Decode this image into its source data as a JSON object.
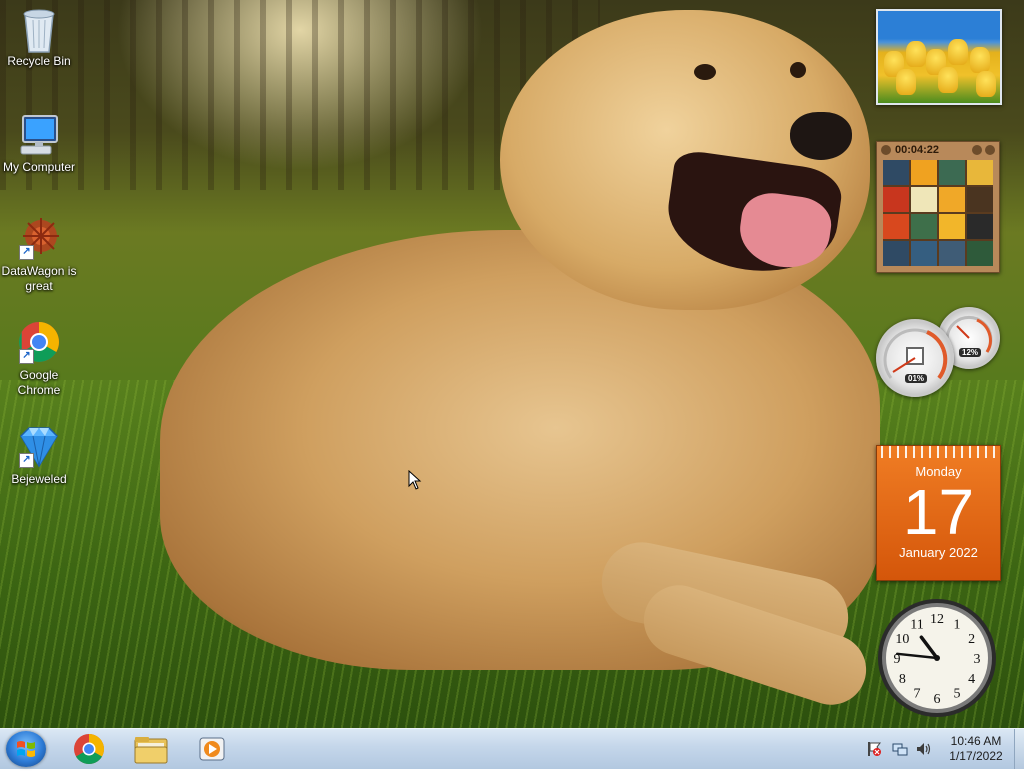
{
  "desktop": {
    "icons": [
      {
        "label": "Recycle Bin",
        "icon": "recycle-bin-icon"
      },
      {
        "label": "My Computer",
        "icon": "computer-icon"
      },
      {
        "label": "DataWagon is great",
        "icon": "datawagon-icon",
        "shortcut": true
      },
      {
        "label": "Google Chrome",
        "icon": "chrome-icon",
        "shortcut": true
      },
      {
        "label": "Bejeweled",
        "icon": "bejeweled-icon",
        "shortcut": true
      }
    ]
  },
  "gadgets": {
    "puzzle": {
      "timer": "00:04:22"
    },
    "meter": {
      "cpu": "01%",
      "memory": "12%"
    },
    "calendar": {
      "day_of_week": "Monday",
      "day": "17",
      "month_year": "January 2022"
    },
    "clock": {
      "numbers": [
        "12",
        "1",
        "2",
        "3",
        "4",
        "5",
        "6",
        "7",
        "8",
        "9",
        "10",
        "11"
      ],
      "hour": 10,
      "minute": 46
    }
  },
  "taskbar": {
    "start": "start-orb",
    "pinned": [
      {
        "name": "taskbar-chrome",
        "icon": "chrome-icon"
      },
      {
        "name": "taskbar-explorer",
        "icon": "folder-icon"
      },
      {
        "name": "taskbar-media-player",
        "icon": "media-player-icon"
      }
    ],
    "tray": {
      "icons": [
        "action-center-flag-icon",
        "network-icon",
        "volume-icon"
      ],
      "time": "10:46 AM",
      "date": "1/17/2022"
    }
  },
  "colors": {
    "calendar": "#e2661a",
    "taskbar": "#c4d6ea"
  }
}
